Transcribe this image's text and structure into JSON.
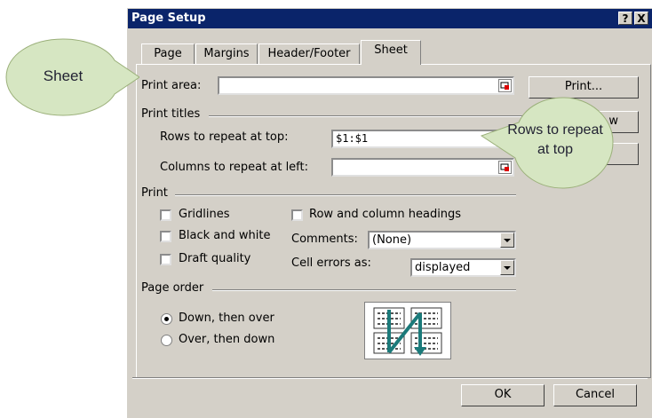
{
  "dialog": {
    "title": "Page Setup",
    "help_label": "?",
    "close_label": "X",
    "tabs": [
      {
        "label": "Page"
      },
      {
        "label": "Margins"
      },
      {
        "label": "Header/Footer"
      },
      {
        "label": "Sheet"
      }
    ],
    "print_area": {
      "label": "Print area:",
      "value": ""
    },
    "print_titles": {
      "label": "Print titles",
      "rows_label": "Rows to repeat at top:",
      "rows_value": "$1:$1",
      "cols_label": "Columns to repeat at left:",
      "cols_value": ""
    },
    "print": {
      "label": "Print",
      "gridlines": "Gridlines",
      "black_and_white": "Black and white",
      "draft_quality": "Draft quality",
      "row_col_headings": "Row and column headings",
      "comments_label": "Comments:",
      "comments_value": "(None)",
      "cell_errors_label": "Cell errors as:",
      "cell_errors_value": "displayed"
    },
    "page_order": {
      "label": "Page order",
      "down_then_over": "Down, then over",
      "over_then_down": "Over, then down"
    },
    "side_buttons": {
      "print": "Print...",
      "preview": "w"
    },
    "ok": "OK",
    "cancel": "Cancel"
  },
  "callouts": {
    "sheet": "Sheet",
    "rows_repeat_line1": "Rows to repeat",
    "rows_repeat_line2": "at top"
  },
  "colors": {
    "titlebar": "#0a246a",
    "dialog_bg": "#d4d0c8",
    "callout": "#d6e6c2",
    "arrow": "#1b7a7a"
  }
}
